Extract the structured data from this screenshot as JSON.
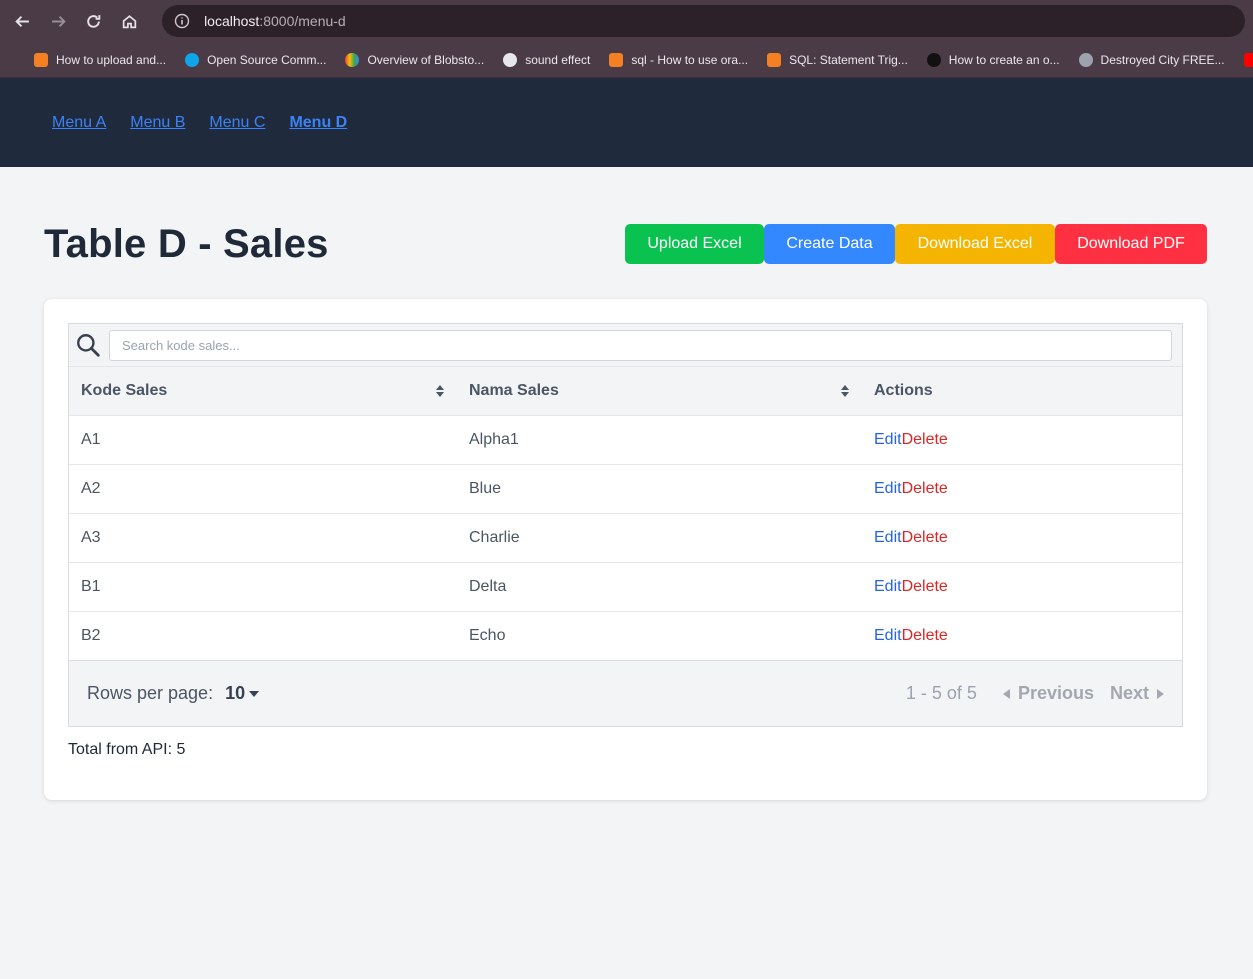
{
  "browser": {
    "url_host": "localhost",
    "url_rest": ":8000/menu-d",
    "bookmarks": [
      {
        "label": "How to upload and...",
        "color": "#f48024"
      },
      {
        "label": "Open Source Comm...",
        "color": "#0ea5e9"
      },
      {
        "label": "Overview of Blobsto...",
        "color": "#34a853"
      },
      {
        "label": "sound effect",
        "color": "#e5e7eb"
      },
      {
        "label": "sql - How to use ora...",
        "color": "#f48024"
      },
      {
        "label": "SQL: Statement Trig...",
        "color": "#f48024"
      },
      {
        "label": "How to create an o...",
        "color": "#111111"
      },
      {
        "label": "Destroyed City FREE...",
        "color": "#9ca3af"
      }
    ]
  },
  "nav": {
    "items": [
      {
        "label": "Menu A",
        "active": false
      },
      {
        "label": "Menu B",
        "active": false
      },
      {
        "label": "Menu C",
        "active": false
      },
      {
        "label": "Menu D",
        "active": true
      }
    ]
  },
  "page": {
    "title": "Table D - Sales",
    "buttons": {
      "upload": "Upload Excel",
      "create": "Create Data",
      "download_excel": "Download Excel",
      "download_pdf": "Download PDF"
    }
  },
  "table": {
    "search_placeholder": "Search kode sales...",
    "columns": {
      "kode": "Kode Sales",
      "nama": "Nama Sales",
      "actions": "Actions"
    },
    "action_labels": {
      "edit": "Edit",
      "delete": "Delete"
    },
    "rows": [
      {
        "kode": "A1",
        "nama": "Alpha1"
      },
      {
        "kode": "A2",
        "nama": "Blue"
      },
      {
        "kode": "A3",
        "nama": "Charlie"
      },
      {
        "kode": "B1",
        "nama": "Delta"
      },
      {
        "kode": "B2",
        "nama": "Echo"
      }
    ],
    "pagination": {
      "rows_label": "Rows per page:",
      "rows_value": "10",
      "range": "1 - 5 of 5",
      "previous": "Previous",
      "next": "Next"
    }
  },
  "footer": {
    "total": "Total from API: 5"
  },
  "colors": {
    "nav_bg": "#1f2a3c",
    "upload": "#0ac24f",
    "create": "#3388ff",
    "download_excel": "#f4b400",
    "download_pdf": "#ff3041"
  }
}
